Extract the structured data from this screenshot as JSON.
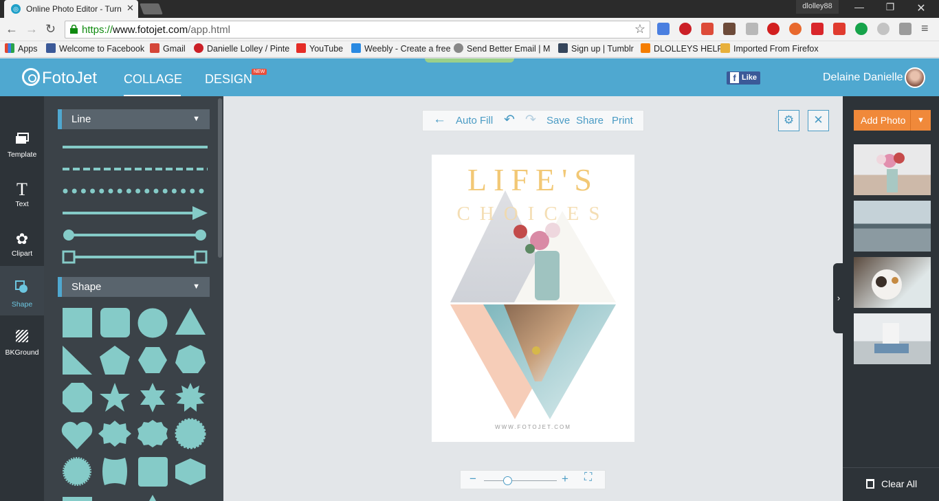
{
  "browser": {
    "tab_title": "Online Photo Editor - Turn",
    "window_user": "dlolley88",
    "url_scheme": "https://",
    "url_host": "www.fotojet.com",
    "url_path": "/app.html"
  },
  "bookmarks": [
    {
      "label": "Apps",
      "color": "#e5452e"
    },
    {
      "label": "Welcome to Facebook",
      "color": "#3b5998"
    },
    {
      "label": "Gmail",
      "color": "#d44638"
    },
    {
      "label": "Danielle Lolley / Pinte",
      "color": "#cb2027"
    },
    {
      "label": "YouTube",
      "color": "#e52d27"
    },
    {
      "label": "Weebly - Create a free",
      "color": "#2a8ae2"
    },
    {
      "label": "Send Better Email | M",
      "color": "#888888"
    },
    {
      "label": "Sign up | Tumblr",
      "color": "#35465c"
    },
    {
      "label": "DLOLLEYS HELP",
      "color": "#f57d00"
    },
    {
      "label": "Imported From Firefox",
      "color": "#e8b03a"
    }
  ],
  "app": {
    "brand": "FotoJet",
    "nav": {
      "collage": "COLLAGE",
      "design": "DESIGN",
      "new_badge": "NEW"
    },
    "fb_like": "Like",
    "user_name": "Delaine Danielle"
  },
  "rail": {
    "items": [
      {
        "label": "Template",
        "icon": "template-icon"
      },
      {
        "label": "Text",
        "icon": "text-icon"
      },
      {
        "label": "Clipart",
        "icon": "clipart-icon"
      },
      {
        "label": "Shape",
        "icon": "shape-icon"
      },
      {
        "label": "BKGround",
        "icon": "background-icon"
      }
    ],
    "active": "Shape"
  },
  "panel": {
    "line_header": "Line",
    "shape_header": "Shape",
    "accent": "#85cbc8"
  },
  "toolbar": {
    "auto_fill": "Auto Fill",
    "save": "Save",
    "share": "Share",
    "print": "Print"
  },
  "poster": {
    "title": "LIFE'S",
    "subtitle": "CHOICES",
    "footer": "WWW.FOTOJET.COM"
  },
  "zoom": {
    "level": 0.33
  },
  "right": {
    "add_photo": "Add Photo",
    "clear_all": "Clear All"
  }
}
